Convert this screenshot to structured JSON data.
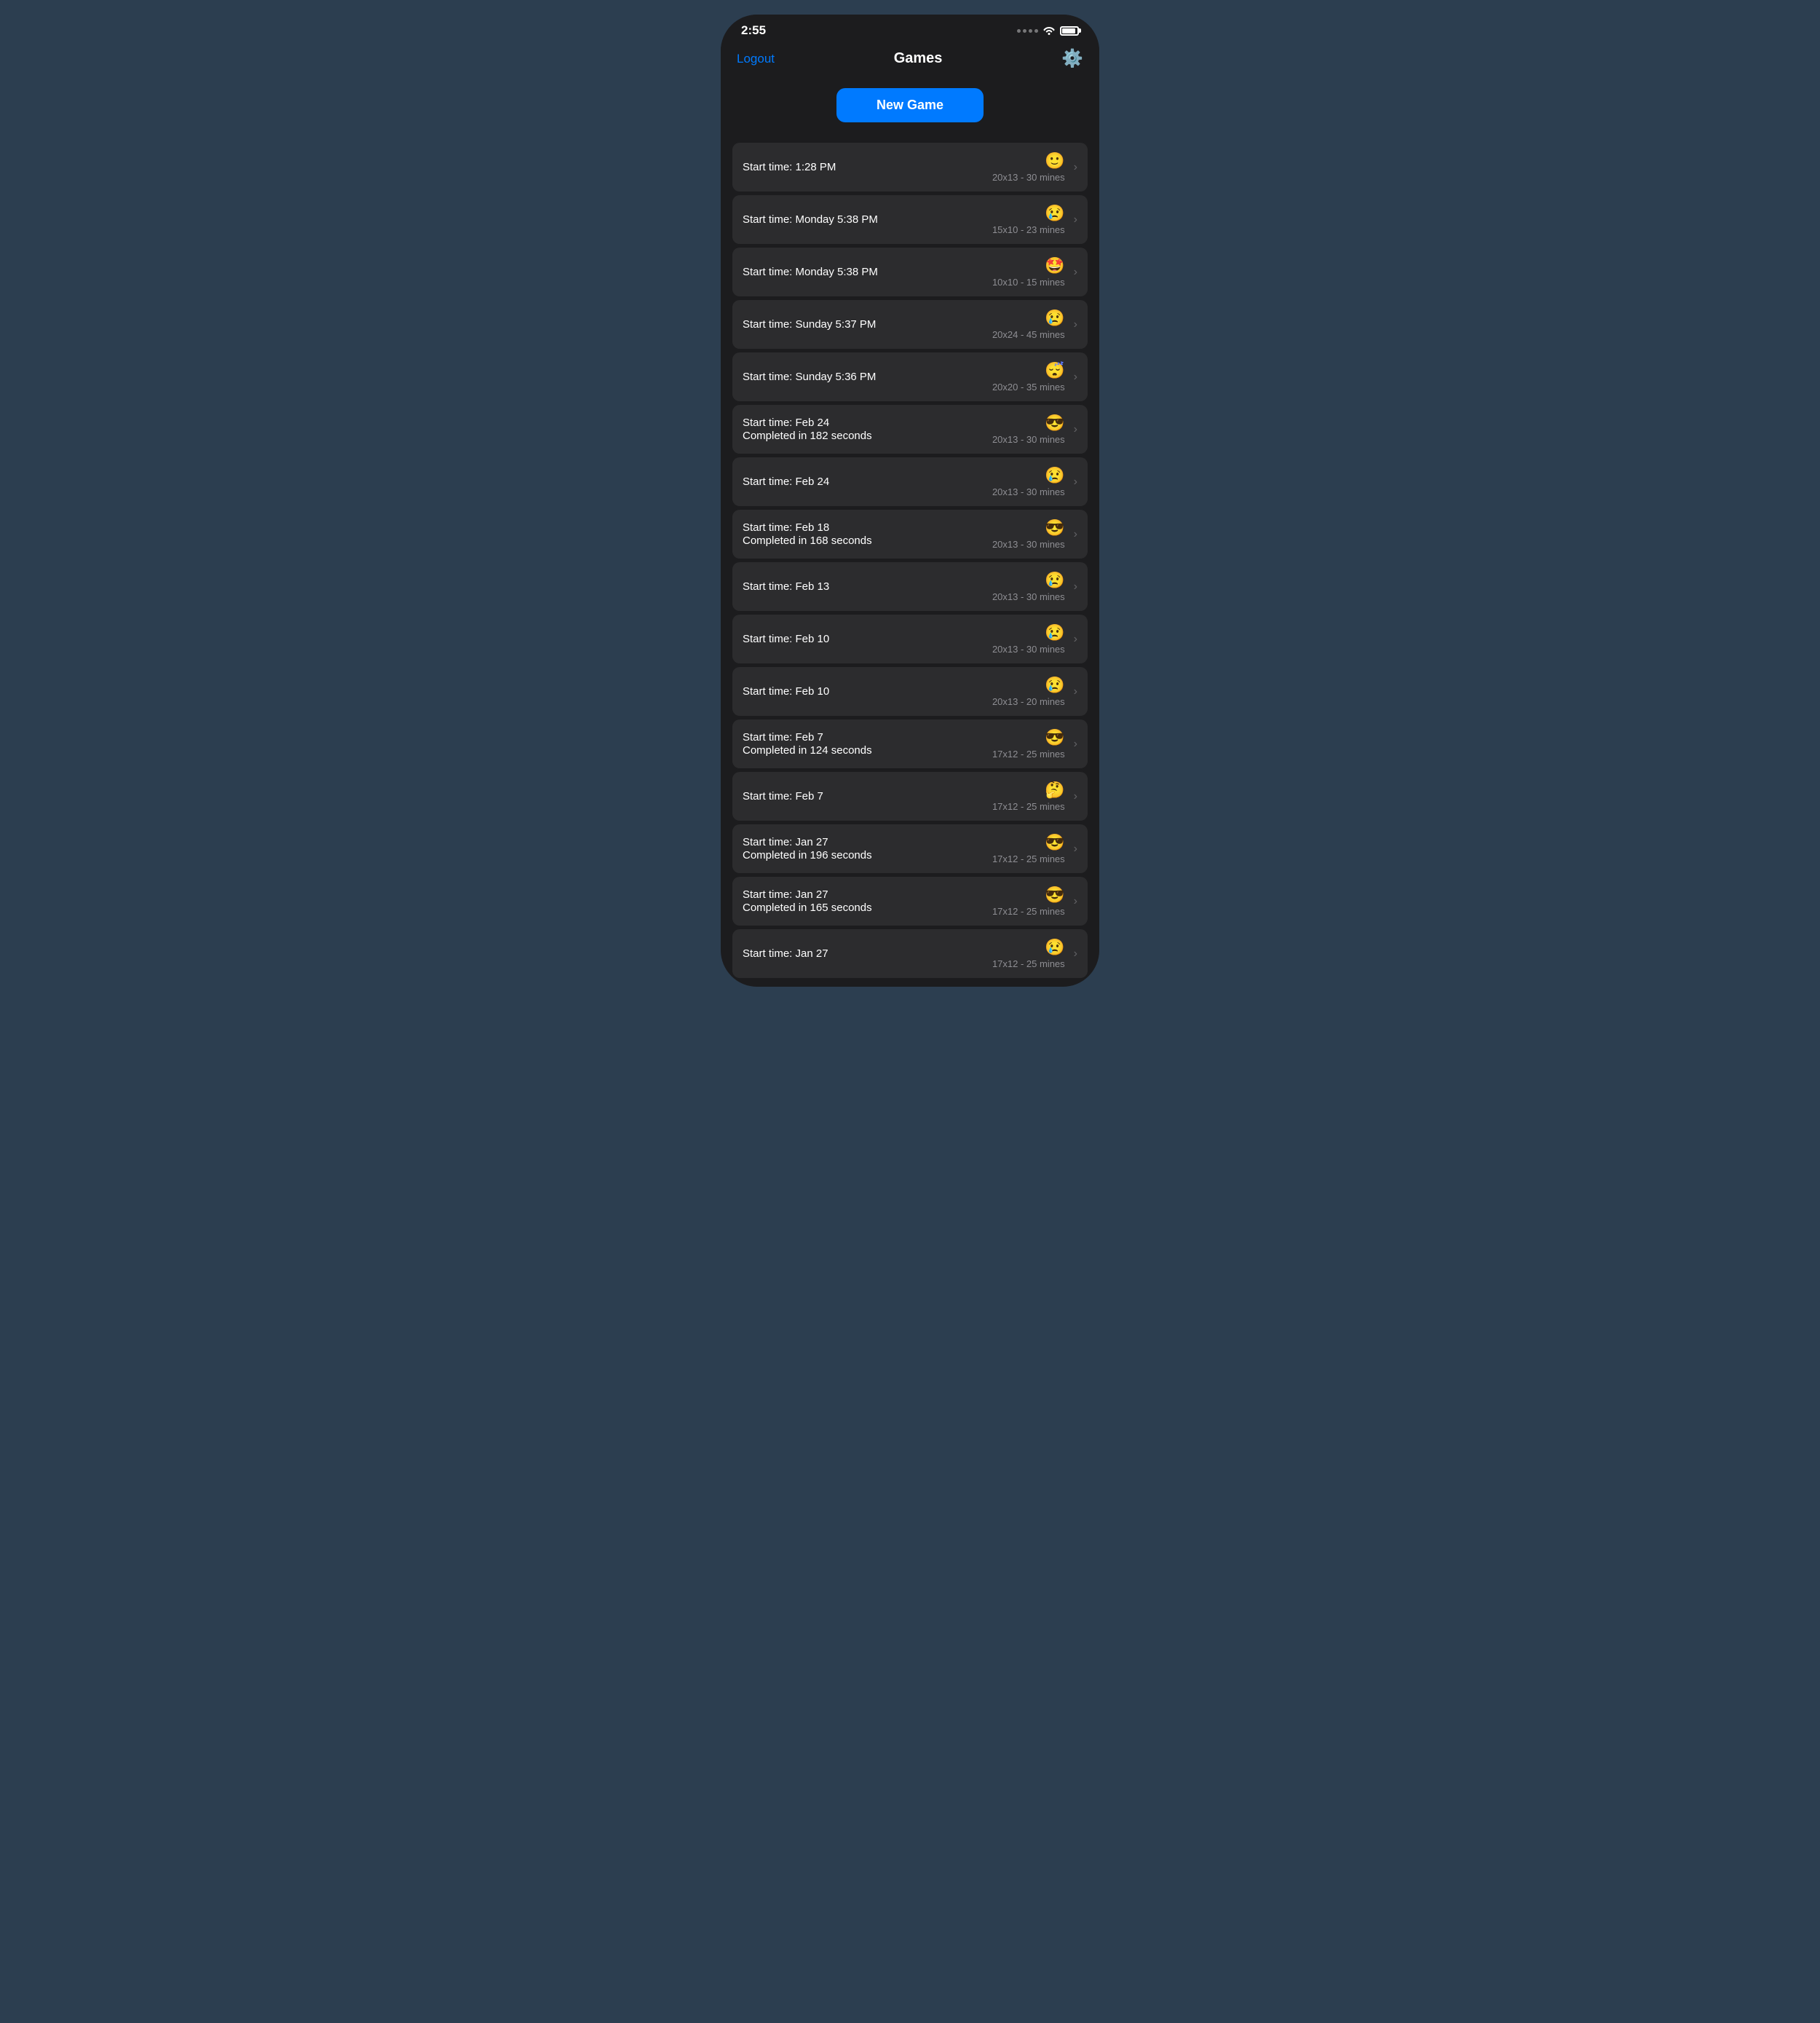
{
  "statusBar": {
    "time": "2:55",
    "wifi": "📶",
    "battery": 80
  },
  "nav": {
    "logout": "Logout",
    "title": "Games",
    "gear": "⚙️"
  },
  "newGameButton": "New Game",
  "games": [
    {
      "startLabel": "Start time:",
      "startTime": "1:28 PM",
      "completed": null,
      "emoji": "🙂",
      "grid": "20x13",
      "mines": "30 mines"
    },
    {
      "startLabel": "Start time:",
      "startTime": "Monday 5:38 PM",
      "completed": null,
      "emoji": "😢",
      "grid": "15x10",
      "mines": "23 mines"
    },
    {
      "startLabel": "Start time:",
      "startTime": "Monday 5:38 PM",
      "completed": null,
      "emoji": "🤩",
      "grid": "10x10",
      "mines": "15 mines"
    },
    {
      "startLabel": "Start time:",
      "startTime": "Sunday 5:37 PM",
      "completed": null,
      "emoji": "😢",
      "grid": "20x24",
      "mines": "45 mines"
    },
    {
      "startLabel": "Start time:",
      "startTime": "Sunday 5:36 PM",
      "completed": null,
      "emoji": "😴",
      "grid": "20x20",
      "mines": "35 mines"
    },
    {
      "startLabel": "Start time:",
      "startTime": "Feb 24",
      "completed": "Completed in 182 seconds",
      "emoji": "😎",
      "grid": "20x13",
      "mines": "30 mines"
    },
    {
      "startLabel": "Start time:",
      "startTime": "Feb 24",
      "completed": null,
      "emoji": "😢",
      "grid": "20x13",
      "mines": "30 mines"
    },
    {
      "startLabel": "Start time:",
      "startTime": "Feb 18",
      "completed": "Completed in 168 seconds",
      "emoji": "😎",
      "grid": "20x13",
      "mines": "30 mines"
    },
    {
      "startLabel": "Start time:",
      "startTime": "Feb 13",
      "completed": null,
      "emoji": "😢",
      "grid": "20x13",
      "mines": "30 mines"
    },
    {
      "startLabel": "Start time:",
      "startTime": "Feb 10",
      "completed": null,
      "emoji": "😢",
      "grid": "20x13",
      "mines": "30 mines"
    },
    {
      "startLabel": "Start time:",
      "startTime": "Feb 10",
      "completed": null,
      "emoji": "😢",
      "grid": "20x13",
      "mines": "20 mines"
    },
    {
      "startLabel": "Start time:",
      "startTime": "Feb 7",
      "completed": "Completed in 124 seconds",
      "emoji": "😎",
      "grid": "17x12",
      "mines": "25 mines"
    },
    {
      "startLabel": "Start time:",
      "startTime": "Feb 7",
      "completed": null,
      "emoji": "🤔",
      "grid": "17x12",
      "mines": "25 mines"
    },
    {
      "startLabel": "Start time:",
      "startTime": "Jan 27",
      "completed": "Completed in 196 seconds",
      "emoji": "😎",
      "grid": "17x12",
      "mines": "25 mines"
    },
    {
      "startLabel": "Start time:",
      "startTime": "Jan 27",
      "completed": "Completed in 165 seconds",
      "emoji": "😎",
      "grid": "17x12",
      "mines": "25 mines"
    },
    {
      "startLabel": "Start time:",
      "startTime": "Jan 27",
      "completed": null,
      "emoji": "😢",
      "grid": "17x12",
      "mines": "25 mines"
    }
  ]
}
